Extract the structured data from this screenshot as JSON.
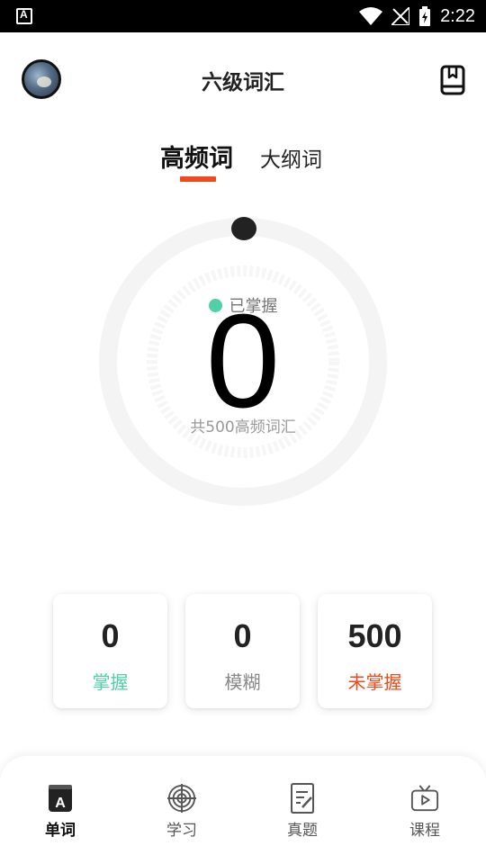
{
  "status_bar": {
    "time": "2:22"
  },
  "header": {
    "title": "六级词汇"
  },
  "tabs": [
    {
      "label": "高频词",
      "active": true
    },
    {
      "label": "大纲词",
      "active": false
    }
  ],
  "progress": {
    "status_label": "已掌握",
    "mastered_count": "0",
    "total_label": "共500高频词汇",
    "fraction": 0
  },
  "stats": [
    {
      "value": "0",
      "label": "掌握",
      "color": "#4fd1a5"
    },
    {
      "value": "0",
      "label": "模糊",
      "color": "#888888"
    },
    {
      "value": "500",
      "label": "未掌握",
      "color": "#f04a1b"
    }
  ],
  "bottom_nav": [
    {
      "label": "单词",
      "icon": "dictionary-icon",
      "active": true
    },
    {
      "label": "学习",
      "icon": "target-icon",
      "active": false
    },
    {
      "label": "真题",
      "icon": "exam-paper-icon",
      "active": false
    },
    {
      "label": "课程",
      "icon": "tv-icon",
      "active": false
    }
  ],
  "colors": {
    "accent": "#f04a1b",
    "mastered": "#4fd1a5",
    "ring": "#f4f4f4"
  }
}
